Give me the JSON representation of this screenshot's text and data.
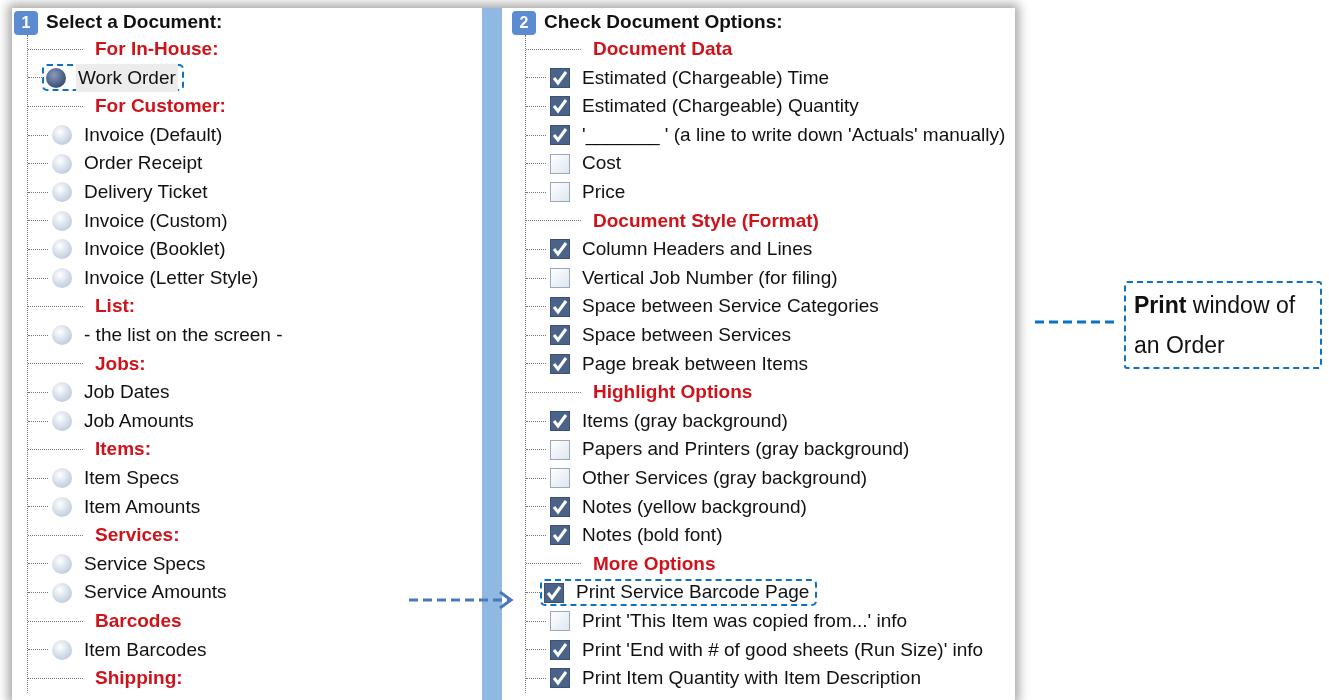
{
  "panels": [
    {
      "number": "1",
      "title": "Select a Document:",
      "items": [
        {
          "kind": "heading",
          "label": "For In-House:"
        },
        {
          "kind": "radio",
          "label": "Work Order",
          "selected": true,
          "highlighted": true
        },
        {
          "kind": "heading",
          "label": "For Customer:"
        },
        {
          "kind": "radio",
          "label": "Invoice (Default)",
          "selected": false,
          "highlighted": false
        },
        {
          "kind": "radio",
          "label": "Order Receipt",
          "selected": false,
          "highlighted": false
        },
        {
          "kind": "radio",
          "label": "Delivery Ticket",
          "selected": false,
          "highlighted": false
        },
        {
          "kind": "radio",
          "label": "Invoice (Custom)",
          "selected": false,
          "highlighted": false
        },
        {
          "kind": "radio",
          "label": "Invoice (Booklet)",
          "selected": false,
          "highlighted": false
        },
        {
          "kind": "radio",
          "label": "Invoice (Letter Style)",
          "selected": false,
          "highlighted": false
        },
        {
          "kind": "heading",
          "label": "List:"
        },
        {
          "kind": "radio",
          "label": "- the list on the screen -",
          "selected": false,
          "highlighted": false
        },
        {
          "kind": "heading",
          "label": "Jobs:"
        },
        {
          "kind": "radio",
          "label": "Job Dates",
          "selected": false,
          "highlighted": false
        },
        {
          "kind": "radio",
          "label": "Job Amounts",
          "selected": false,
          "highlighted": false
        },
        {
          "kind": "heading",
          "label": "Items:"
        },
        {
          "kind": "radio",
          "label": "Item Specs",
          "selected": false,
          "highlighted": false
        },
        {
          "kind": "radio",
          "label": "Item Amounts",
          "selected": false,
          "highlighted": false
        },
        {
          "kind": "heading",
          "label": "Services:"
        },
        {
          "kind": "radio",
          "label": "Service Specs",
          "selected": false,
          "highlighted": false
        },
        {
          "kind": "radio",
          "label": "Service Amounts",
          "selected": false,
          "highlighted": false
        },
        {
          "kind": "heading",
          "label": "Barcodes"
        },
        {
          "kind": "radio",
          "label": "Item Barcodes",
          "selected": false,
          "highlighted": false
        },
        {
          "kind": "heading",
          "label": "Shipping:"
        }
      ]
    },
    {
      "number": "2",
      "title": "Check Document Options:",
      "items": [
        {
          "kind": "heading",
          "label": "Document Data"
        },
        {
          "kind": "checkbox",
          "label": "Estimated (Chargeable) Time",
          "checked": true,
          "highlighted": false
        },
        {
          "kind": "checkbox",
          "label": "Estimated (Chargeable) Quantity",
          "checked": true,
          "highlighted": false
        },
        {
          "kind": "checkbox",
          "label": "'_______ ' (a line to write down 'Actuals' manually)",
          "checked": true,
          "highlighted": false
        },
        {
          "kind": "checkbox",
          "label": "Cost",
          "checked": false,
          "highlighted": false
        },
        {
          "kind": "checkbox",
          "label": "Price",
          "checked": false,
          "highlighted": false
        },
        {
          "kind": "heading",
          "label": "Document Style (Format)"
        },
        {
          "kind": "checkbox",
          "label": "Column Headers and Lines",
          "checked": true,
          "highlighted": false
        },
        {
          "kind": "checkbox",
          "label": "Vertical Job Number (for filing)",
          "checked": false,
          "highlighted": false
        },
        {
          "kind": "checkbox",
          "label": "Space between Service Categories",
          "checked": true,
          "highlighted": false
        },
        {
          "kind": "checkbox",
          "label": "Space between Services",
          "checked": true,
          "highlighted": false
        },
        {
          "kind": "checkbox",
          "label": "Page break between Items",
          "checked": true,
          "highlighted": false
        },
        {
          "kind": "heading",
          "label": "Highlight Options"
        },
        {
          "kind": "checkbox",
          "label": "Items (gray background)",
          "checked": true,
          "highlighted": false
        },
        {
          "kind": "checkbox",
          "label": "Papers and Printers (gray background)",
          "checked": false,
          "highlighted": false
        },
        {
          "kind": "checkbox",
          "label": "Other Services (gray background)",
          "checked": false,
          "highlighted": false
        },
        {
          "kind": "checkbox",
          "label": "Notes (yellow background)",
          "checked": true,
          "highlighted": false
        },
        {
          "kind": "checkbox",
          "label": "Notes (bold font)",
          "checked": true,
          "highlighted": false
        },
        {
          "kind": "heading",
          "label": "More Options"
        },
        {
          "kind": "checkbox",
          "label": "Print Service Barcode Page",
          "checked": true,
          "highlighted": true
        },
        {
          "kind": "checkbox",
          "label": "Print 'This Item was copied from...' info",
          "checked": false,
          "highlighted": false
        },
        {
          "kind": "checkbox",
          "label": "Print 'End with # of good sheets (Run Size)' info",
          "checked": true,
          "highlighted": false
        },
        {
          "kind": "checkbox",
          "label": "Print Item Quantity with Item Description",
          "checked": true,
          "highlighted": false
        }
      ]
    }
  ],
  "callout": {
    "text": "**Print** window of an Order"
  }
}
